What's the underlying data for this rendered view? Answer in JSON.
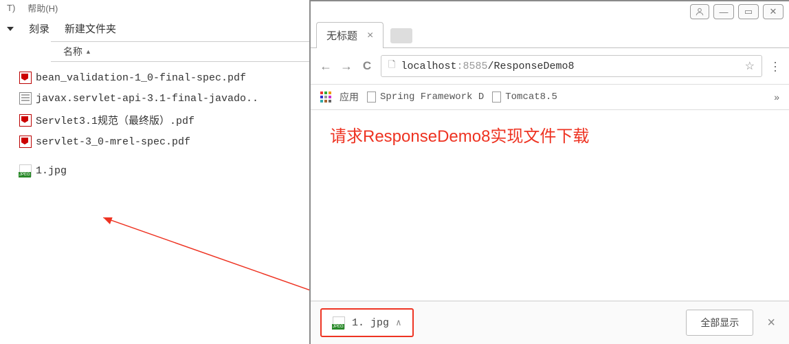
{
  "explorer": {
    "topbar": {
      "t": "T)",
      "help": "帮助(H)"
    },
    "toolbar": {
      "burn": "刻录",
      "newfolder": "新建文件夹"
    },
    "column_header": "名称",
    "files": [
      {
        "type": "pdf",
        "name": "bean_validation-1_0-final-spec.pdf"
      },
      {
        "type": "doc",
        "name": "javax.servlet-api-3.1-final-javado.."
      },
      {
        "type": "pdf",
        "name": "Servlet3.1规范（最终版）.pdf"
      },
      {
        "type": "pdf",
        "name": "servlet-3_0-mrel-spec.pdf"
      },
      {
        "type": "jpeg",
        "name": "1.jpg"
      }
    ]
  },
  "browser": {
    "tab_title": "无标题",
    "url": {
      "host": "localhost",
      "port": ":8585",
      "path": "/ResponseDemo8"
    },
    "bookmarks": {
      "apps_label": "应用",
      "items": [
        {
          "label": "Spring Framework D"
        },
        {
          "label": "Tomcat8.5"
        }
      ]
    },
    "headline": "请求ResponseDemo8实现文件下载",
    "download": {
      "filename": "1. jpg"
    },
    "show_all": "全部显示"
  }
}
